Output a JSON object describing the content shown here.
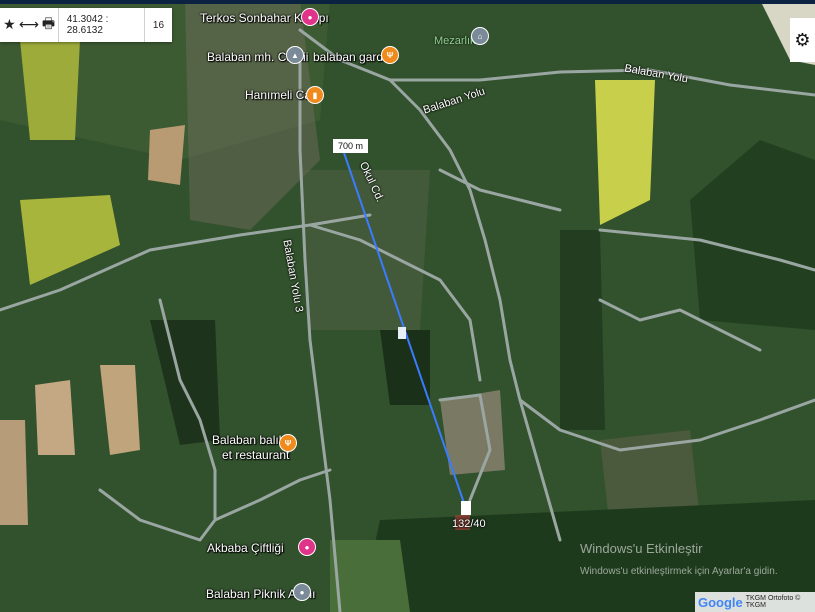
{
  "toolbar": {
    "favorite_icon": "★",
    "measure_icon": "⟷",
    "print_icon": "🖶",
    "coordinates": "41.3042 : 28.6132",
    "zoom": "16"
  },
  "settings_icon": "⚙",
  "places": {
    "terkos": "Terkos Sonbahar Kampı",
    "cami": "Balaban mh. Camii",
    "garden": "balaban garden",
    "cafe": "Hanımeli Cafe",
    "mezarlik": "Mezarlık",
    "balik": "Balaban balık",
    "balik2": "et restaurant",
    "akbaba": "Akbaba Çiftliği",
    "piknik": "Balaban Piknik Alanı"
  },
  "roads": {
    "yolu_top": "Balaban Yolu",
    "yolu_mid": "Balaban Yolu",
    "yolu3": "Balaban Yolu 3",
    "okul": "Okul Cd."
  },
  "measure": {
    "distance": "700 m"
  },
  "parcel": "132/40",
  "watermark": {
    "line1": "Windows'u Etkinleştir",
    "line2": "Windows'u etkinleştirmek için Ayarlar'a gidin."
  },
  "credit": {
    "google": "Google",
    "text": "TKGM Ortofoto © TKGM"
  },
  "colors": {
    "measure_line": "#3a7bff",
    "poi_pink": "#e0338a",
    "poi_orange": "#f08a1c",
    "poi_gray": "#7b8a99"
  }
}
